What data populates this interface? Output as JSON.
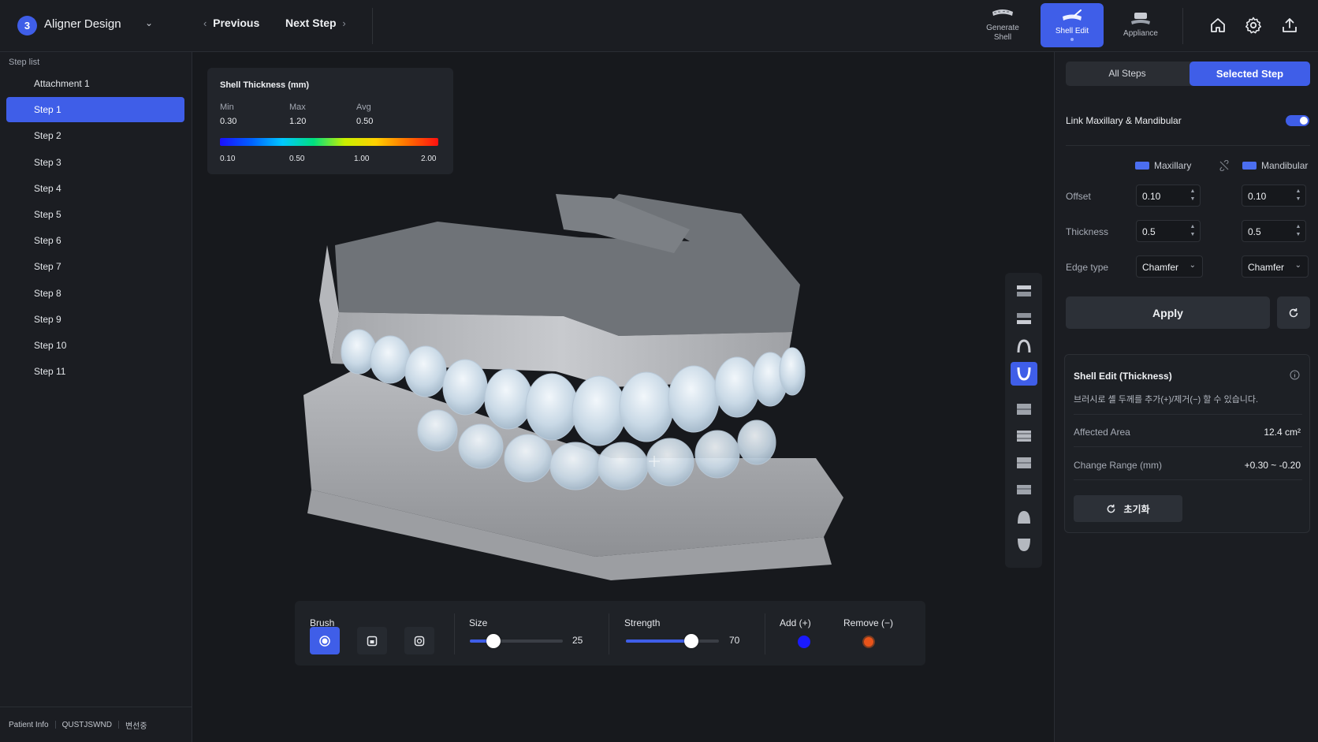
{
  "header": {
    "step_number": "3",
    "stage_title": "Aligner Design",
    "previous_label": "Previous",
    "next_label": "Next Step",
    "modes": [
      {
        "label_line1": "Generate",
        "label_line2": "Shell",
        "icon": "arch-shell-icon"
      },
      {
        "label_line1": "Shell Edit",
        "label_line2": "",
        "icon": "shell-edit-icon"
      },
      {
        "label_line1": "Appliance",
        "label_line2": "",
        "icon": "appliance-icon"
      }
    ],
    "active_mode": "Shell Edit"
  },
  "sidebar": {
    "heading": "Step list",
    "items": [
      "Attachment 1",
      "Step 1",
      "Step 2",
      "Step 3",
      "Step 4",
      "Step 5",
      "Step 6",
      "Step 7",
      "Step 8",
      "Step 9",
      "Step 10",
      "Step 11"
    ],
    "active_item": "Step 1",
    "footer": {
      "label": "Patient Info",
      "patient_id": "QUSTJSWND",
      "status": "변선중"
    }
  },
  "thickness_panel": {
    "title": "Shell Thickness (mm)",
    "min_label": "Min",
    "max_label": "Max",
    "avg_label": "Avg",
    "min_value": "0.30",
    "max_value": "1.20",
    "avg_value": "0.50",
    "scale_ticks": [
      "0.10",
      "0.50",
      "1.00",
      "2.00"
    ]
  },
  "brush_bar": {
    "brush_label": "Brush",
    "size_label": "Size",
    "size_value": 25,
    "size_max": 100,
    "strength_label": "Strength",
    "strength_value": 70,
    "strength_max": 100,
    "add_label": "Add (+)",
    "remove_label": "Remove (−)",
    "add_color": "#1a1aff",
    "remove_color": "#e8541a"
  },
  "right_panel": {
    "scope_all": "All Steps",
    "scope_selected": "Selected Step",
    "link_label": "Link Maxillary & Mandibular",
    "link_enabled": true,
    "col_maxillary": "Maxillary",
    "col_mandibular": "Mandibular",
    "offset_label": "Offset",
    "thickness_label": "Thickness",
    "edge_label": "Edge type",
    "maxillary": {
      "offset": "0.10",
      "thickness": "0.5",
      "edge": "Chamfer"
    },
    "mandibular": {
      "offset": "0.10",
      "thickness": "0.5",
      "edge": "Chamfer"
    },
    "apply_label": "Apply",
    "card": {
      "title": "Shell Edit (Thickness)",
      "description": "브러시로 셸 두께를 추가(+)/제거(−) 할 수 있습니다.",
      "affected_label": "Affected Area",
      "affected_value": "12.4 cm²",
      "range_label": "Change Range (mm)",
      "range_value": "+0.30 ~ -0.20",
      "reset_label": "초기화"
    }
  },
  "colors": {
    "accent": "#3f5ee8",
    "background": "#16181d",
    "panel": "#1b1d22"
  }
}
